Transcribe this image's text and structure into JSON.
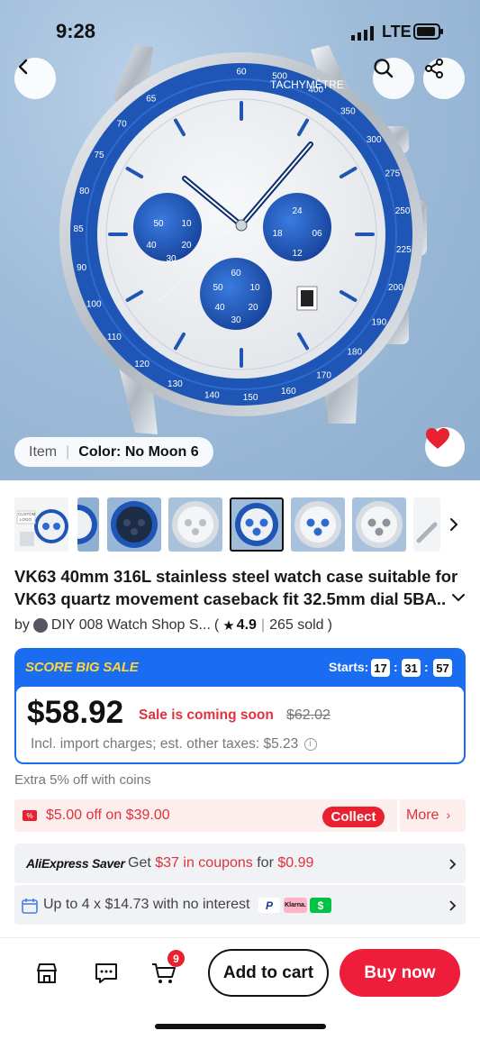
{
  "status": {
    "time": "9:28",
    "network": "LTE"
  },
  "hero": {
    "variant_label": "Item",
    "variant_value": "Color: No Moon 6",
    "bezel_text": "TACHYMÈTRE",
    "subdial_left": [
      "50",
      "10",
      "40",
      "20",
      "30"
    ],
    "subdial_right": [
      "24",
      "18",
      "06",
      "12"
    ],
    "subdial_bottom": [
      "60",
      "50",
      "10",
      "40",
      "20",
      "30"
    ],
    "bezel_numbers": [
      "60",
      "500",
      "400",
      "350",
      "300",
      "275",
      "250",
      "225",
      "200",
      "190",
      "180",
      "170",
      "160",
      "150",
      "140",
      "130",
      "120",
      "110",
      "100",
      "90",
      "85",
      "80",
      "75",
      "70",
      "65"
    ]
  },
  "product": {
    "title": "VK63 40mm 316L stainless steel  watch case suitable for VK63 quartz movement caseback fit 32.5mm dial 5BA..",
    "seller_prefix": "by",
    "seller_name": "DIY 008 Watch Shop S...",
    "rating": "4.9",
    "sold": "265 sold",
    "thumb_logo_text": "CUSTOM LOGO"
  },
  "sale": {
    "label": "SCORE BIG SALE",
    "starts_label": "Starts:",
    "countdown": [
      "17",
      "31",
      "57"
    ],
    "price": "$58.92",
    "status": "Sale is coming soon",
    "original_price": "$62.02",
    "import_note": "Incl. import charges; est. other taxes: $5.23"
  },
  "coins": "Extra 5% off with coins",
  "coupon": {
    "text": "$5.00 off on $39.00",
    "collect": "Collect",
    "more": "More"
  },
  "saver": {
    "logo": "AliExpress Saver",
    "text_pre": "Get",
    "text_amount": "$37 in coupons",
    "text_mid": "for",
    "text_price": "$0.99"
  },
  "installments": {
    "text": "Up to 4 x $14.73 with no interest",
    "klarna": "Klarna."
  },
  "bottom": {
    "cart_count": "9",
    "add_to_cart": "Add to cart",
    "buy_now": "Buy now"
  },
  "colors": {
    "accent_red": "#ee1d3a",
    "sale_blue": "#1a6cf0",
    "sale_yellow": "#ffd633",
    "bezel_blue": "#1f56b5"
  }
}
